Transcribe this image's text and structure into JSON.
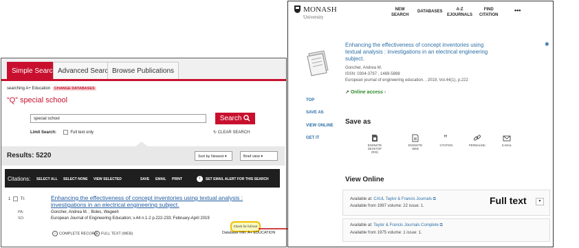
{
  "left_panel": {
    "tabs": [
      "Simple Search",
      "Advanced Search",
      "Browse Publications"
    ],
    "searching_label": "searching A+ Education",
    "change_databases": "CHANGE DATABASES",
    "query_display": "“Q” special school",
    "search_input_value": "special school",
    "search_button": "Search",
    "limit_search_label": "Limit Search:",
    "full_text_only": "Full text only",
    "clear_search": "CLEAR SEARCH",
    "results": "Results: 5220",
    "sort_select": "Sort by Newest",
    "view_select": "Brief view",
    "citations_label": "Citations:",
    "citation_actions": [
      "SELECT ALL",
      "SELECT NONE",
      "VIEW SELECTED",
      "SAVE",
      "EMAIL",
      "PRINT"
    ],
    "email_alert": "SET EMAIL ALERT FOR THIS SEARCH",
    "record": {
      "number": "1",
      "ti_label": "TI:",
      "title": "Enhancing the effectiveness of concept inventories using textual analysis : investigations in an electrical engineering subject.",
      "pa_label": "PA:",
      "authors": "Goncher, Andrea M.  ;  Boles, Wageeh",
      "so_label": "SO:",
      "source": "European Journal of Engineering Education; v.44 n.1-2 p.222-233; February-April 2019",
      "complete_record": "COMPLETE RECORD",
      "full_text_web": "FULL TEXT (WEB)",
      "check_for_full_text": "Check for full text",
      "database_info": "Database Info: A+ EDUCATION"
    }
  },
  "right_panel": {
    "logo_name": "MONASH",
    "logo_sub": "University",
    "nav_items": [
      "NEW\nSEARCH",
      "DATABASES",
      "A-Z\nEJOURNALS",
      "FIND\nCITATION"
    ],
    "more": "•••",
    "article_title": "Enhancing the effectiveness of concept inventories using textual analysis : investigations in an electrical engineering subject.",
    "author": "Goncher, Andrea M.",
    "issn": "ISSN: 0304-3797 , 1469-5898",
    "journal": "European journal of engineering education. , 2019, Vol.44(1), p.222",
    "online_access": "Online access",
    "side_links": [
      "TOP",
      "SAVE AS",
      "VIEW ONLINE",
      "GET IT"
    ],
    "save_as_heading": "Save as",
    "save_options": [
      "ENDNOTE\nDESKTOP\n(RIS)",
      "ENDNOTE\nWEB",
      "CITATION",
      "PERMALINK",
      "E-MAIL"
    ],
    "view_online_heading": "View Online",
    "sources": [
      {
        "available_at": "Available at:",
        "provider": "CAUL Taylor & Francis Journals",
        "coverage": "Available from 1997 volume: 22 issue: 1."
      },
      {
        "available_at": "Available at:",
        "provider": "Taylor & Francis Journals Complete",
        "coverage": "Available from 1975 volume: 1 issue: 1."
      }
    ],
    "full_text_annotation": "Full text"
  },
  "colors": {
    "accent_red": "#c8102e",
    "annotation_red": "#c00000",
    "link_blue": "#2c6fa6",
    "online_green": "#2a8a2a"
  },
  "icons": [
    "search-icon",
    "refresh-icon",
    "info-icon",
    "document-icon",
    "quote-icon",
    "link-icon",
    "mail-icon",
    "external-link-icon",
    "pin-icon"
  ]
}
